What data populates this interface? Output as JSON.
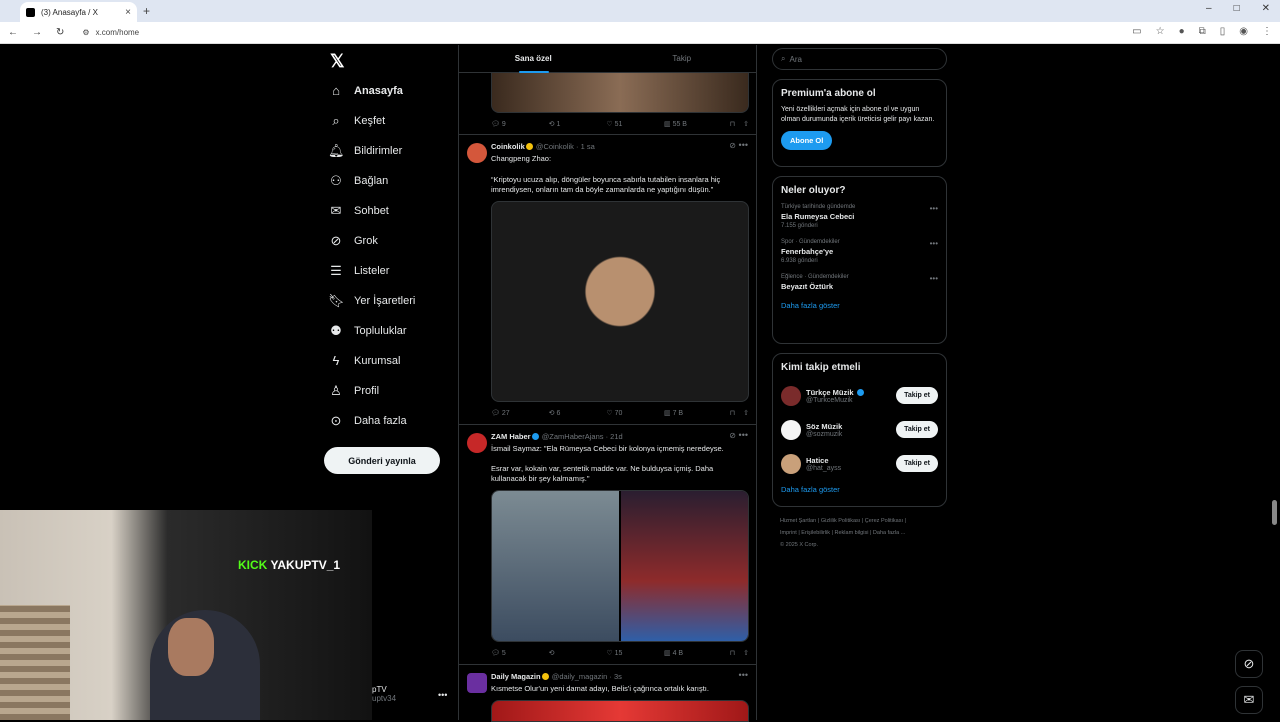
{
  "browser": {
    "tab_title": "(3) Anasayfa / X",
    "url": "x.com/home"
  },
  "nav": {
    "items": [
      {
        "label": "Anasayfa",
        "icon": "home-icon"
      },
      {
        "label": "Keşfet",
        "icon": "search-icon"
      },
      {
        "label": "Bildirimler",
        "icon": "bell-icon"
      },
      {
        "label": "Bağlan",
        "icon": "add-person-icon"
      },
      {
        "label": "Sohbet",
        "icon": "mail-icon"
      },
      {
        "label": "Grok",
        "icon": "grok-icon"
      },
      {
        "label": "Listeler",
        "icon": "list-icon"
      },
      {
        "label": "Yer İşaretleri",
        "icon": "bookmark-icon"
      },
      {
        "label": "Topluluklar",
        "icon": "people-icon"
      },
      {
        "label": "Kurumsal",
        "icon": "bolt-icon"
      },
      {
        "label": "Profil",
        "icon": "person-icon"
      },
      {
        "label": "Daha fazla",
        "icon": "more-circle-icon"
      }
    ],
    "post_button": "Gönderi yayınla",
    "account_name": "pTV",
    "account_handle": "uptv34"
  },
  "stream": {
    "badge_brand": "KICK",
    "channel": "YAKUPTV_1"
  },
  "feed": {
    "tabs": [
      "Sana özel",
      "Takip"
    ],
    "tweet0_actions": {
      "reply": "9",
      "repost": "1",
      "like": "51",
      "views": "55 B"
    },
    "tweets": [
      {
        "name": "Coinkolik",
        "handle": "@Coinkolik",
        "time": "· 1 sa",
        "line1": "Changpeng Zhao:",
        "line2": "“Kriptoyu ucuza alıp, döngüler boyunca sabırla tutabilen insanlara hiç imrendiysen, onların tam da böyle zamanlarda ne yaptığını düşün.”",
        "actions": {
          "reply": "27",
          "repost": "6",
          "like": "70",
          "views": "7 B"
        }
      },
      {
        "name": "ZAM Haber",
        "handle": "@ZamHaberAjans",
        "time": "· 21d",
        "line1": "İsmail Saymaz: \"Ela Rümeysa Cebeci bir kolonya içmemiş neredeyse.",
        "line2": "Esrar var, kokain var, sentetik madde var. Ne bulduysa içmiş. Daha kullanacak bir şey kalmamış.\"",
        "actions": {
          "reply": "5",
          "repost": "",
          "like": "15",
          "views": "4 B"
        }
      },
      {
        "name": "Daily Magazin",
        "handle": "@daily_magazin",
        "time": "· 3s",
        "line1": "Kısmetse Olur'un yeni damat adayı, Belis'i çağrınca ortalık karıştı."
      }
    ]
  },
  "sidebar": {
    "search_placeholder": "Ara",
    "premium": {
      "title": "Premium'a abone ol",
      "text": "Yeni özellikleri açmak için abone ol ve uygun olman durumunda içerik üreticisi gelir payı kazan.",
      "button": "Abone Ol"
    },
    "trends": {
      "title": "Neler oluyor?",
      "items": [
        {
          "context": "Türkiye tarihinde gündemde",
          "topic": "Ela Rumeysa Cebeci",
          "count": "7.155 gönderi"
        },
        {
          "context": "Spor · Gündemdekiler",
          "topic": "Fenerbahçe'ye",
          "count": "6.938 gönderi"
        },
        {
          "context": "Eğlence · Gündemdekiler",
          "topic": "Beyazıt Öztürk",
          "count": ""
        }
      ],
      "more": "Daha fazla göster"
    },
    "who_to_follow": {
      "title": "Kimi takip etmeli",
      "items": [
        {
          "name": "Türkçe Müzik",
          "handle": "@TurkceMuzik",
          "button": "Takip et",
          "color": "#7a2b2b"
        },
        {
          "name": "Söz Müzik",
          "handle": "@sozmuzik",
          "button": "Takip et",
          "color": "#f5f5f5"
        },
        {
          "name": "Hatice",
          "handle": "@hat_ayss",
          "button": "Takip et",
          "color": "#c9a07a"
        }
      ],
      "more": "Daha fazla göster"
    },
    "footer": {
      "line1": "Hizmet Şartları  |  Gizlilik Politikası  |  Çerez Politikası  |",
      "line2": "Imprint  |  Erişilebilirlik  |  Reklam bilgisi  |  Daha fazla ...",
      "line3": "© 2025 X Corp."
    }
  }
}
